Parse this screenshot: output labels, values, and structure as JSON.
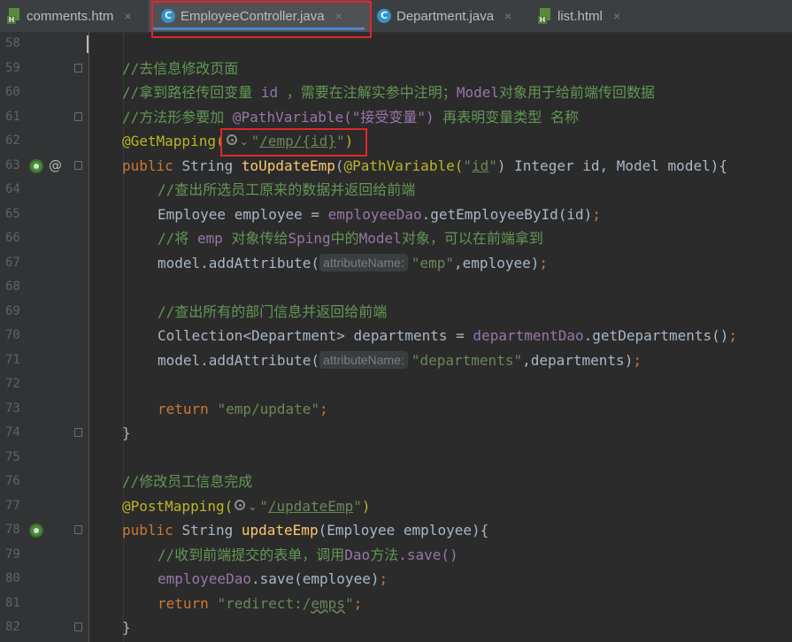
{
  "tabs": [
    {
      "label": "comments.htm",
      "icon": "html-file-icon",
      "close": "×"
    },
    {
      "label": "EmployeeController.java",
      "icon": "java-class-icon",
      "close": "×"
    },
    {
      "label": "Department.java",
      "icon": "java-class-icon",
      "close": "×"
    },
    {
      "label": "list.html",
      "icon": "html-file-icon",
      "close": "×"
    }
  ],
  "editor": {
    "caret_line": "58",
    "lines": [
      {
        "n": "58"
      },
      {
        "n": "59",
        "t": [
          "//去信息修改页面"
        ]
      },
      {
        "n": "60",
        "t": [
          "//拿到路径传回变量 ",
          "id",
          " ，需要在注解实参中注明；",
          "Model",
          "对象用于给前端传回数据"
        ]
      },
      {
        "n": "61",
        "t": [
          "//方法形参要加 ",
          "@PathVariable(\"接受变量\")",
          " 再表明变量类型 名称"
        ]
      },
      {
        "n": "62",
        "t": [
          "@GetMapping(",
          "\"",
          "/emp/{id}",
          "\"",
          ")"
        ]
      },
      {
        "n": "63",
        "t": [
          "public ",
          "String ",
          "toUpdateEmp",
          "(",
          "@PathVariable(",
          "\"",
          "id",
          "\"",
          ") Integer id, Model model){"
        ]
      },
      {
        "n": "64",
        "t": [
          "//查出所选员工原来的数据并返回给前端"
        ]
      },
      {
        "n": "65",
        "t": [
          "Employee employee = ",
          "employeeDao",
          ".getEmployeeById(id)",
          ";"
        ]
      },
      {
        "n": "66",
        "t": [
          "//将 ",
          "emp",
          " 对象传给",
          "Sping",
          "中的",
          "Model",
          "对象，可以在前端拿到"
        ]
      },
      {
        "n": "67",
        "t": [
          "model.addAttribute(",
          "attributeName:",
          "\"emp\"",
          ",employee)",
          ";"
        ]
      },
      {
        "n": "68"
      },
      {
        "n": "69",
        "t": [
          "//查出所有的部门信息并返回给前端"
        ]
      },
      {
        "n": "70",
        "t": [
          "Collection<Department> departments = ",
          "departmentDao",
          ".getDepartments()",
          ";"
        ]
      },
      {
        "n": "71",
        "t": [
          "model.addAttribute(",
          "attributeName:",
          "\"departments\"",
          ",departments)",
          ";"
        ]
      },
      {
        "n": "72"
      },
      {
        "n": "73",
        "t": [
          "return ",
          "\"emp/update\"",
          ";"
        ]
      },
      {
        "n": "74",
        "t": [
          "}"
        ]
      },
      {
        "n": "75"
      },
      {
        "n": "76",
        "t": [
          "//修改员工信息完成"
        ]
      },
      {
        "n": "77",
        "t": [
          "@PostMapping(",
          "\"",
          "/updateEmp",
          "\"",
          ")"
        ]
      },
      {
        "n": "78",
        "t": [
          "public ",
          "String ",
          "updateEmp",
          "(Employee employee){"
        ]
      },
      {
        "n": "79",
        "t": [
          "//收到前端提交的表单，调用",
          "Dao",
          "方法",
          ".save()"
        ]
      },
      {
        "n": "80",
        "t": [
          "employeeDao",
          ".save(employee)",
          ";"
        ]
      },
      {
        "n": "81",
        "t": [
          "return ",
          "\"redirect:/",
          "emps",
          "\"",
          ";"
        ]
      },
      {
        "n": "82",
        "t": [
          "}"
        ]
      }
    ]
  },
  "colors": {
    "background": "#2b2b2b",
    "comment": "#629755",
    "annotation": "#bbb529",
    "keyword": "#cc7832",
    "method": "#ffc66d",
    "string": "#6a8759",
    "field": "#9876aa",
    "highlight_box": "#e0262c"
  }
}
